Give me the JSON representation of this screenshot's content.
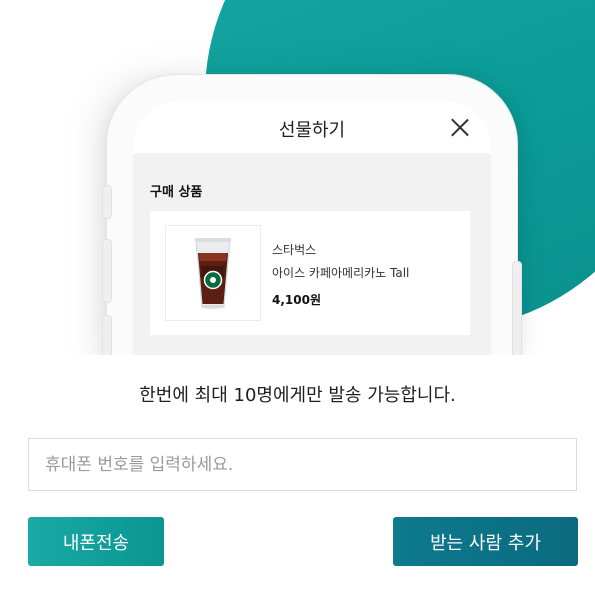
{
  "colors": {
    "accent_teal": "#14a39f",
    "accent_dark_teal": "#0c6f85",
    "screen_bg": "#f2f2f2"
  },
  "modal": {
    "title": "선물하기",
    "close_icon": "close-icon"
  },
  "purchase": {
    "section_title": "구매 상품",
    "product": {
      "brand": "스타벅스",
      "name": "아이스 카페아메리카노 Tall",
      "price": "4,100원",
      "image_icon": "iced-coffee-cup"
    }
  },
  "notice": "한번에 최대 10명에게만 발송 가능합니다.",
  "phone_input": {
    "value": "",
    "placeholder": "휴대폰 번호를 입력하세요."
  },
  "buttons": {
    "send_my_phone": "내폰전송",
    "add_recipient": "받는 사람 추가"
  }
}
